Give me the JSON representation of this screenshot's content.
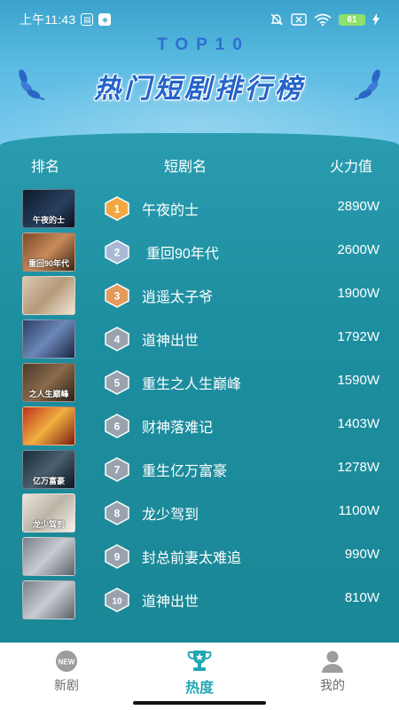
{
  "status_bar": {
    "time": "上午11:43",
    "battery": "61"
  },
  "header": {
    "top_label": "TOP10",
    "title": "热门短剧排行榜"
  },
  "columns": {
    "rank": "排名",
    "name": "短剧名",
    "heat": "火力值"
  },
  "rows": [
    {
      "rank": "1",
      "name": "午夜的士",
      "heat": "2890W",
      "thumb_text": "午夜的士",
      "medal": "gold"
    },
    {
      "rank": "2",
      "name": "重回90年代",
      "heat": "2600W",
      "thumb_text": "重回90年代",
      "medal": "silver"
    },
    {
      "rank": "3",
      "name": "逍遥太子爷",
      "heat": "1900W",
      "thumb_text": "",
      "medal": "bronze"
    },
    {
      "rank": "4",
      "name": "道神出世",
      "heat": "1792W",
      "thumb_text": "",
      "medal": "gray"
    },
    {
      "rank": "5",
      "name": "重生之人生巅峰",
      "heat": "1590W",
      "thumb_text": "之人生巅峰",
      "medal": "gray"
    },
    {
      "rank": "6",
      "name": "财神落难记",
      "heat": "1403W",
      "thumb_text": "",
      "medal": "gray"
    },
    {
      "rank": "7",
      "name": "重生亿万富豪",
      "heat": "1278W",
      "thumb_text": "亿万富豪",
      "medal": "gray"
    },
    {
      "rank": "8",
      "name": "龙少驾到",
      "heat": "1100W",
      "thumb_text": "龙少驾到",
      "medal": "gray"
    },
    {
      "rank": "9",
      "name": "封总前妻太难追",
      "heat": "990W",
      "thumb_text": "",
      "medal": "gray"
    },
    {
      "rank": "10",
      "name": "道神出世",
      "heat": "810W",
      "thumb_text": "",
      "medal": "gray"
    }
  ],
  "nav": {
    "items": [
      {
        "label": "新剧",
        "icon": "new-badge-icon",
        "active": false
      },
      {
        "label": "热度",
        "icon": "trophy-icon",
        "active": true
      },
      {
        "label": "我的",
        "icon": "user-icon",
        "active": false
      }
    ]
  },
  "colors": {
    "accent": "#22a7b4",
    "panel": "#1d8e9f",
    "title": "#2463c9",
    "gold": "#f2a743",
    "silver": "#a9b8d4",
    "bronze": "#e39a5b",
    "gray_badge": "#9aa3ad"
  }
}
